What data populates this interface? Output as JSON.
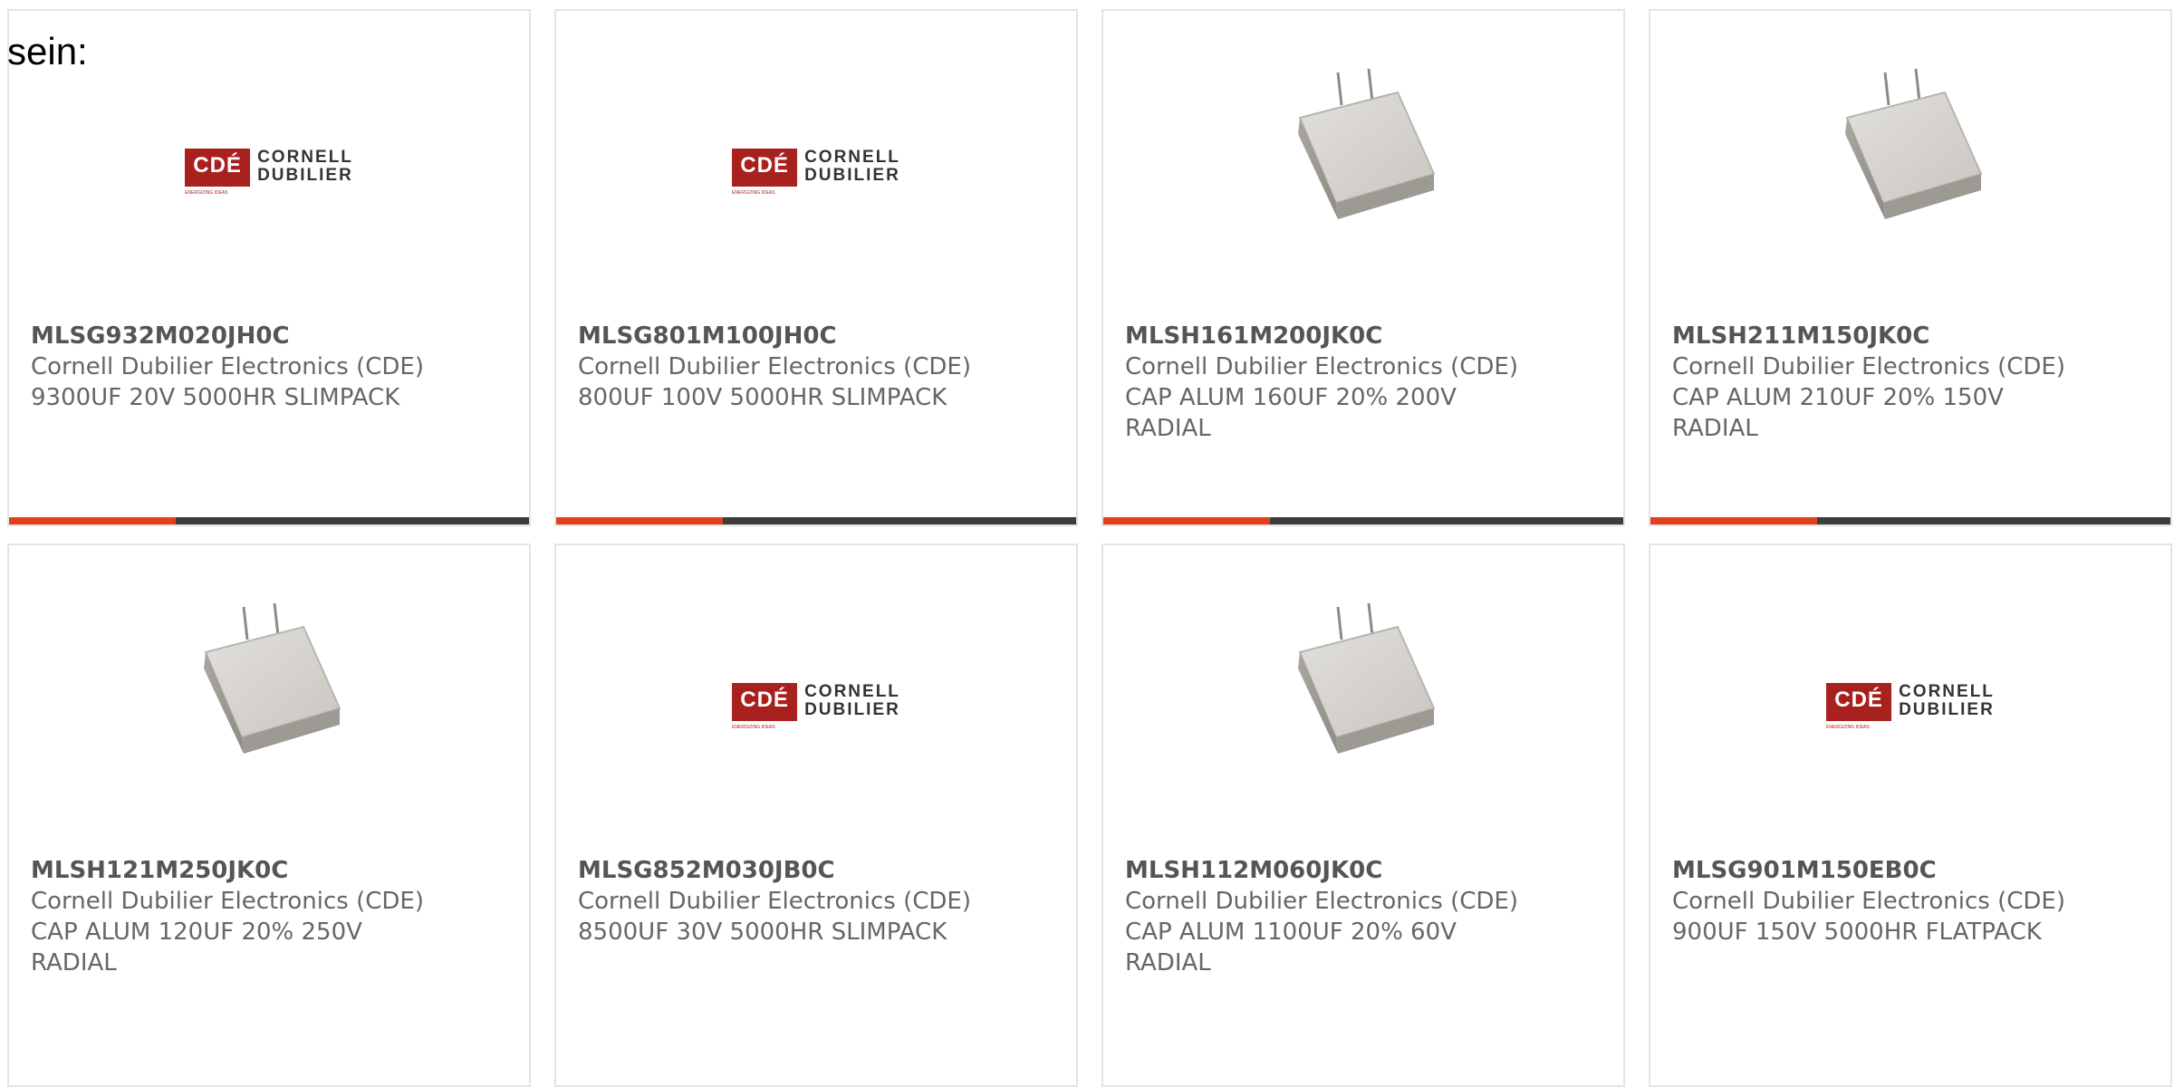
{
  "heading": "sein:",
  "colors": {
    "accent": "#e2401c",
    "bar": "#3d3d3d",
    "brand_red": "#a8211f"
  },
  "brand": {
    "mark": "CDÉ",
    "word1": "CORNELL",
    "word2": "DUBILIER",
    "tagline": "ENERGIZING IDEAS"
  },
  "products": [
    {
      "part": "MLSG932M020JH0C",
      "maker": "Cornell Dubilier Electronics (CDE)",
      "desc": [
        "9300UF 20V 5000HR SLIMPACK"
      ],
      "image": "cde-logo",
      "progress": 0.32
    },
    {
      "part": "MLSG801M100JH0C",
      "maker": "Cornell Dubilier Electronics (CDE)",
      "desc": [
        "800UF 100V 5000HR SLIMPACK"
      ],
      "image": "cde-logo",
      "progress": 0.32
    },
    {
      "part": "MLSH161M200JK0C",
      "maker": "Cornell Dubilier Electronics (CDE)",
      "desc": [
        "CAP ALUM 160UF 20% 200V",
        "RADIAL"
      ],
      "image": "capacitor",
      "progress": 0.32
    },
    {
      "part": "MLSH211M150JK0C",
      "maker": "Cornell Dubilier Electronics (CDE)",
      "desc": [
        "CAP ALUM 210UF 20% 150V",
        "RADIAL"
      ],
      "image": "capacitor",
      "progress": 0.32
    },
    {
      "part": "MLSH121M250JK0C",
      "maker": "Cornell Dubilier Electronics (CDE)",
      "desc": [
        "CAP ALUM 120UF 20% 250V",
        "RADIAL"
      ],
      "image": "capacitor",
      "progress": null
    },
    {
      "part": "MLSG852M030JB0C",
      "maker": "Cornell Dubilier Electronics (CDE)",
      "desc": [
        "8500UF 30V 5000HR SLIMPACK"
      ],
      "image": "cde-logo",
      "progress": null
    },
    {
      "part": "MLSH112M060JK0C",
      "maker": "Cornell Dubilier Electronics (CDE)",
      "desc": [
        "CAP ALUM 1100UF 20% 60V",
        "RADIAL"
      ],
      "image": "capacitor",
      "progress": null
    },
    {
      "part": "MLSG901M150EB0C",
      "maker": "Cornell Dubilier Electronics (CDE)",
      "desc": [
        "900UF 150V 5000HR FLATPACK"
      ],
      "image": "cde-logo",
      "progress": null
    }
  ]
}
